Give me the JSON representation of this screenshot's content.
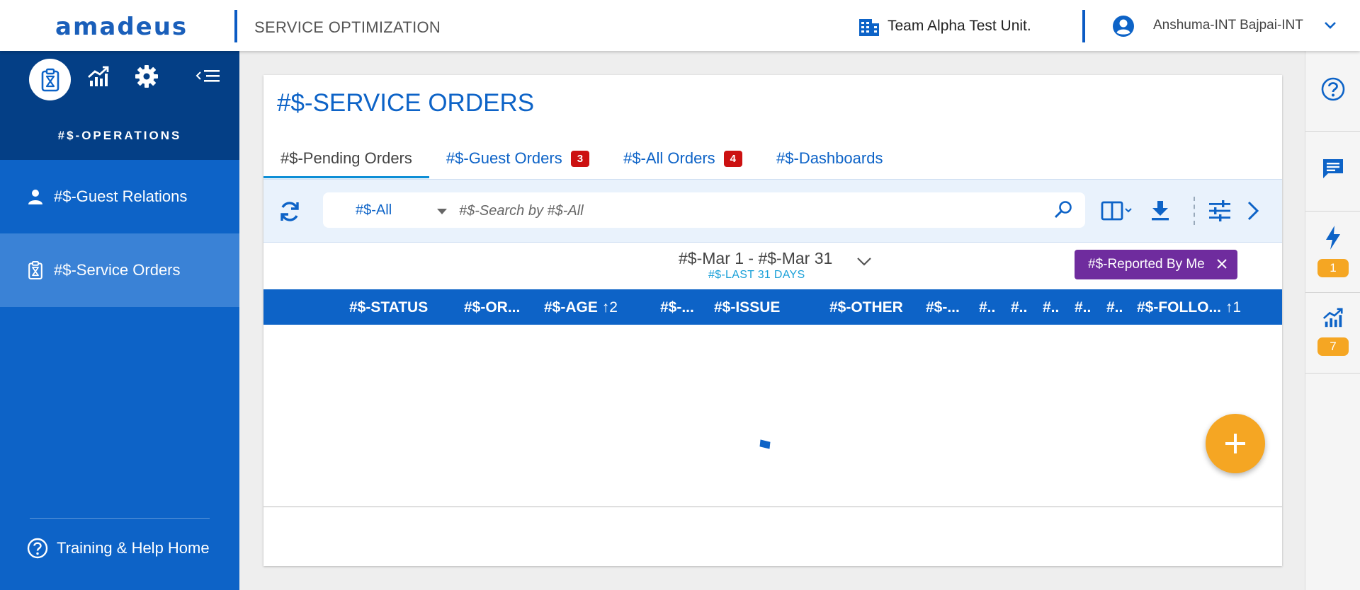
{
  "header": {
    "logo": "amadeus",
    "app_title": "SERVICE OPTIMIZATION",
    "hotel_icon": "building-icon",
    "hotel_name": "Team Alpha Test Unit.",
    "user_icon": "account-circle-icon",
    "user_name": "Anshuma-INT Bajpai-INT"
  },
  "sidebar": {
    "modules": [
      {
        "icon": "clipboard-hourglass-icon",
        "active": true
      },
      {
        "icon": "trending-chart-icon",
        "active": false
      },
      {
        "icon": "gear-icon",
        "active": false
      },
      {
        "icon": "collapse-menu-icon",
        "active": false
      }
    ],
    "section_title": "#$-OPERATIONS",
    "items": [
      {
        "label": "#$-Guest Relations",
        "icon": "person-icon",
        "active": false
      },
      {
        "label": "#$-Service Orders",
        "icon": "clipboard-hourglass-icon",
        "active": true
      }
    ],
    "help_label": "Training & Help Home"
  },
  "main": {
    "title": "#$-SERVICE ORDERS",
    "tabs": [
      {
        "label": "#$-Pending Orders",
        "badge": "",
        "active": true
      },
      {
        "label": "#$-Guest Orders",
        "badge": "3",
        "active": false
      },
      {
        "label": "#$-All Orders",
        "badge": "4",
        "active": false
      },
      {
        "label": "#$-Dashboards",
        "badge": "",
        "active": false
      }
    ],
    "search": {
      "scope": "#$-All",
      "placeholder": "#$-Search by #$-All"
    },
    "date_range": "#$-Mar 1 - #$-Mar 31",
    "date_sub": "#$-LAST 31 DAYS",
    "filter_chip": "#$-Reported By Me",
    "columns": [
      {
        "label": "#$-STATUS",
        "sort": ""
      },
      {
        "label": "#$-OR...",
        "sort": ""
      },
      {
        "label": "#$-AGE",
        "sort": "↑2"
      },
      {
        "label": "#$-...",
        "sort": ""
      },
      {
        "label": "#$-ISSUE",
        "sort": ""
      },
      {
        "label": "#$-OTHER",
        "sort": ""
      },
      {
        "label": "#$-...",
        "sort": ""
      },
      {
        "label": "#..",
        "sort": ""
      },
      {
        "label": "#..",
        "sort": ""
      },
      {
        "label": "#..",
        "sort": ""
      },
      {
        "label": "#..",
        "sort": ""
      },
      {
        "label": "#..",
        "sort": ""
      },
      {
        "label": "#$-FOLLO...",
        "sort": "↑1"
      }
    ]
  },
  "rail": {
    "items": [
      {
        "icon": "help-circle-icon",
        "badge": ""
      },
      {
        "icon": "chat-icon",
        "badge": ""
      },
      {
        "icon": "lightning-icon",
        "badge": "1"
      },
      {
        "icon": "trending-chart-icon",
        "badge": "7"
      }
    ]
  },
  "colors": {
    "brand": "#0d63c7",
    "sidebar_dark": "#043f86",
    "badge_red": "#cc1111",
    "chip_purple": "#6f2c9e",
    "accent_orange": "#f5a623"
  }
}
